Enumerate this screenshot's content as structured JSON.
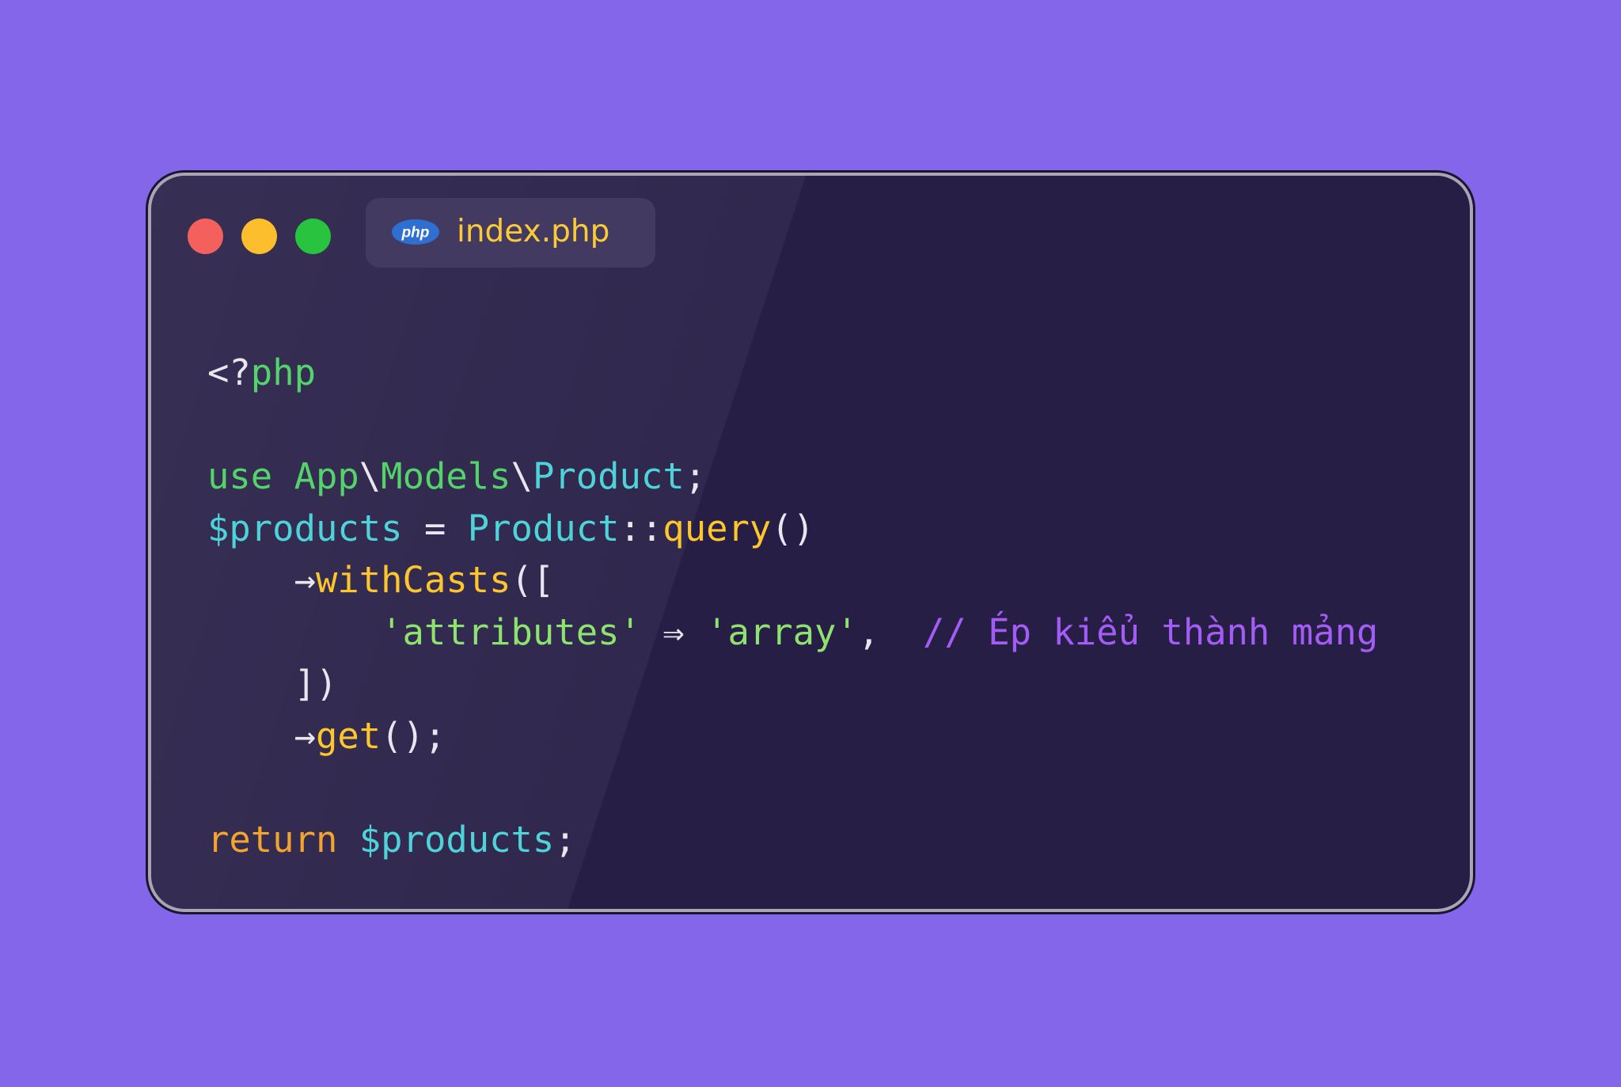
{
  "colors": {
    "background": "#8466ea",
    "window": "#271e46",
    "window_border": "#a9a5b5",
    "tab": "#433a62",
    "traffic_red": "#f4605b",
    "traffic_yellow": "#fdbe2e",
    "traffic_green": "#29c43f",
    "tab_label": "#fcc937"
  },
  "window": {
    "controls": [
      "close",
      "minimize",
      "maximize"
    ],
    "tab": {
      "icon": "php-logo-icon",
      "icon_text": "php",
      "label": "index.php"
    }
  },
  "code": {
    "language": "php",
    "lines": [
      [
        {
          "t": "<?",
          "c": "punct"
        },
        {
          "t": "php",
          "c": "green"
        }
      ],
      [],
      [
        {
          "t": "use ",
          "c": "green"
        },
        {
          "t": "App",
          "c": "green"
        },
        {
          "t": "\\",
          "c": "punct"
        },
        {
          "t": "Models",
          "c": "green"
        },
        {
          "t": "\\",
          "c": "punct"
        },
        {
          "t": "Product",
          "c": "cyan"
        },
        {
          "t": ";",
          "c": "punct"
        }
      ],
      [
        {
          "t": "$products",
          "c": "cyan"
        },
        {
          "t": " = ",
          "c": "punct"
        },
        {
          "t": "Product",
          "c": "cyan"
        },
        {
          "t": "::",
          "c": "punct"
        },
        {
          "t": "query",
          "c": "yellow"
        },
        {
          "t": "()",
          "c": "punct"
        }
      ],
      [
        {
          "t": "    ",
          "c": "punct"
        },
        {
          "t": "→",
          "c": "punct"
        },
        {
          "t": "withCasts",
          "c": "yellow"
        },
        {
          "t": "([",
          "c": "punct"
        }
      ],
      [
        {
          "t": "        ",
          "c": "punct"
        },
        {
          "t": "'attributes'",
          "c": "string"
        },
        {
          "t": " ⇒ ",
          "c": "punct"
        },
        {
          "t": "'array'",
          "c": "string"
        },
        {
          "t": ",  ",
          "c": "punct"
        },
        {
          "t": "// Ép kiểu thành mảng",
          "c": "comment"
        }
      ],
      [
        {
          "t": "    ",
          "c": "punct"
        },
        {
          "t": "])",
          "c": "punct"
        }
      ],
      [
        {
          "t": "    ",
          "c": "punct"
        },
        {
          "t": "→",
          "c": "punct"
        },
        {
          "t": "get",
          "c": "yellow"
        },
        {
          "t": "();",
          "c": "punct"
        }
      ],
      [],
      [
        {
          "t": "return",
          "c": "orange"
        },
        {
          "t": " ",
          "c": "punct"
        },
        {
          "t": "$products",
          "c": "cyan"
        },
        {
          "t": ";",
          "c": "punct"
        }
      ]
    ]
  }
}
